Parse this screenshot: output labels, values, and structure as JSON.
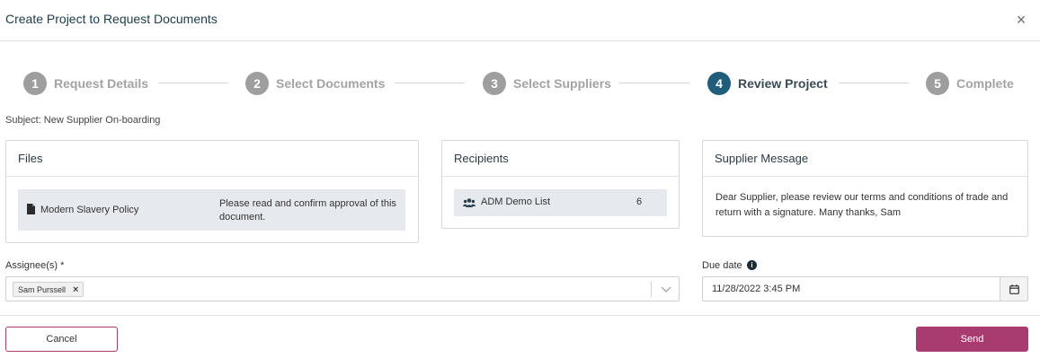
{
  "modal": {
    "title": "Create Project to Request Documents",
    "close_icon": "close-icon"
  },
  "stepper": {
    "active_step": 4,
    "steps": [
      {
        "number": "1",
        "label": "Request Details"
      },
      {
        "number": "2",
        "label": "Select Documents"
      },
      {
        "number": "3",
        "label": "Select Suppliers"
      },
      {
        "number": "4",
        "label": "Review Project"
      },
      {
        "number": "5",
        "label": "Complete"
      }
    ]
  },
  "subject": "Subject: New Supplier On-boarding",
  "files": {
    "title": "Files",
    "items": [
      {
        "icon": "document-icon",
        "name": "Modern Slavery Policy",
        "note": "Please read and confirm approval of this document."
      }
    ]
  },
  "recipients": {
    "title": "Recipients",
    "items": [
      {
        "icon": "users-icon",
        "name": "ADM Demo List",
        "count": "6"
      }
    ]
  },
  "supplier_message": {
    "title": "Supplier Message",
    "text": "Dear Supplier, please review our terms and conditions of trade and return with a signature. Many thanks, Sam"
  },
  "assignees": {
    "label": "Assignee(s) *",
    "selected": [
      "Sam Purssell"
    ],
    "remove_glyph": "×"
  },
  "due_date": {
    "label": "Due date",
    "info_glyph": "i",
    "value": "11/28/2022 3:45 PM"
  },
  "footer": {
    "cancel_label": "Cancel",
    "send_label": "Send"
  },
  "colors": {
    "brand_primary": "#a83c70",
    "step_active": "#1f5d7a",
    "step_inactive": "#9e9e9e"
  }
}
